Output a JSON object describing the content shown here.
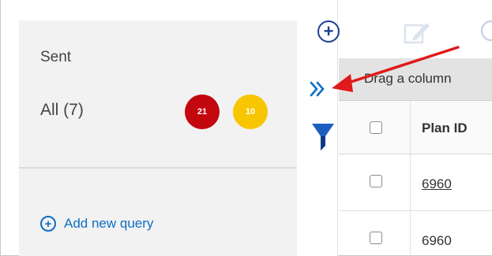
{
  "queries": {
    "sent_label": "Sent",
    "all_label": "All (7)",
    "badges": [
      {
        "value": "21",
        "color": "#c2070e"
      },
      {
        "value": "10",
        "color": "#f7c600"
      }
    ],
    "add_new_label": "Add new query"
  },
  "toolbar": {
    "icons": [
      "add-circle-icon",
      "edit-icon",
      "partial-icon"
    ]
  },
  "rail": {
    "icons": [
      "expand-chevrons-icon",
      "filter-icon"
    ]
  },
  "grid": {
    "group_hint": "Drag a column",
    "columns": [
      "Plan ID"
    ],
    "rows": [
      {
        "plan_id": "6960",
        "linked": true
      },
      {
        "plan_id": "6960",
        "linked": false
      }
    ]
  },
  "colors": {
    "accent": "#0d6ec4",
    "navy": "#1c3f8e",
    "annotation_arrow": "#e0191a"
  }
}
